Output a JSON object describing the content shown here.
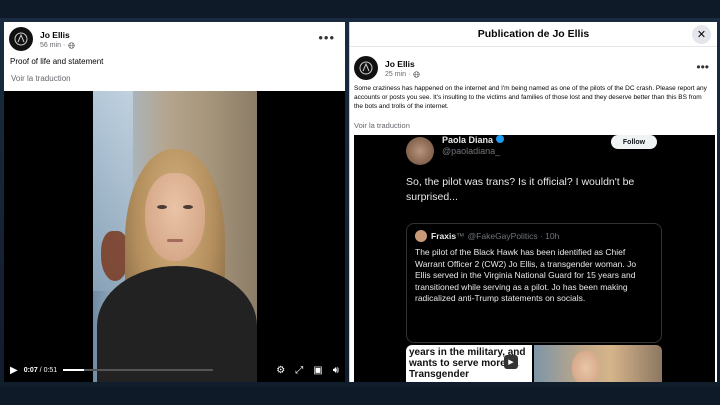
{
  "left_post": {
    "author": "Jo Ellis",
    "timestamp": "56 min",
    "text": "Proof of life and statement",
    "translate_link": "Voir la traduction",
    "video": {
      "current_time": "0:07",
      "separator": " / ",
      "duration": "0:51",
      "progress_fraction": 0.14
    }
  },
  "right_post": {
    "dialog_title": "Publication de Jo Ellis",
    "author": "Jo Ellis",
    "timestamp": "25 min",
    "text": "Some craziness has happened on the internet and I'm being named as one of the pilots of the DC crash. Please report any accounts or posts you see. It's insulting to the victims and families of those lost and they deserve better than this BS from the bots and trolls of the internet.",
    "translate_link": "Voir la traduction",
    "tweet": {
      "name": "Paola Diana",
      "handle": "@paoladiana_",
      "follow_label": "Follow",
      "text": "So, the pilot was trans? Is it official? I wouldn't be surprised...",
      "quote": {
        "name": "Fraxis",
        "name_suffix": "™",
        "handle": "@FakeGayPolitics · 10h",
        "text": "The pilot of the Black Hawk has been identified as Chief Warrant Officer 2 (CW2) Jo Ellis, a transgender woman. Jo Ellis served in the Virginia National Guard for 15 years and transitioned while serving as a pilot. Jo has been making radicalized anti-Trump statements on socials."
      },
      "media_text": "years in the military, and wants to serve more: A Transgender"
    }
  },
  "colors": {
    "facebook_gray": "#65676b",
    "x_blue": "#1d9bf0",
    "background": "#1b2c40"
  },
  "icons": [
    "globe-icon",
    "more-options-icon",
    "close-icon",
    "play-icon",
    "settings-icon",
    "fullscreen-icon",
    "pip-icon",
    "volume-icon",
    "verified-icon"
  ]
}
